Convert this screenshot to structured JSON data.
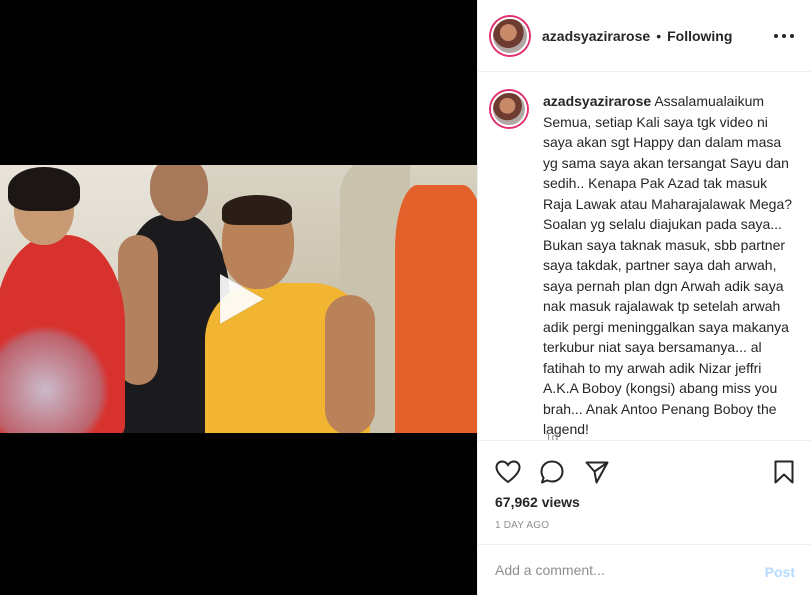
{
  "post": {
    "username": "azadsyazirarose",
    "separator": "•",
    "follow_status": "Following",
    "caption": "Assalamualaikum Semua, setiap Kali saya tgk video ni saya akan sgt Happy dan dalam masa yg sama saya akan tersangat Sayu dan sedih.. Kenapa Pak Azad tak masuk Raja Lawak atau Maharajalawak Mega? Soalan yg selalu diajukan pada saya... Bukan saya taknak masuk, sbb partner saya takdak, partner saya dah arwah, saya pernah plan dgn Arwah adik saya nak masuk rajalawak tp setelah arwah adik pergi meninggalkan saya makanya terkubur niat saya bersamanya... al fatihah to my arwah adik Nizar jeffri A.K.A Boboy (kongsi) abang miss you brah... Anak Antoo Penang Boboy the lagend!",
    "caption_age": "1d",
    "views": "67,962 views",
    "time_ago": "1 DAY AGO"
  },
  "comment": {
    "placeholder": "Add a comment...",
    "post_label": "Post"
  },
  "icons": {
    "more": "more-horizontal-icon",
    "like": "heart-icon",
    "comment": "comment-bubble-icon",
    "share": "paper-plane-icon",
    "save": "bookmark-icon",
    "play": "play-icon"
  },
  "colors": {
    "text": "#262626",
    "muted": "#8e8e8e",
    "border": "#efefef",
    "post_disabled": "#b3dbff",
    "story_ring": "#e1306c"
  }
}
